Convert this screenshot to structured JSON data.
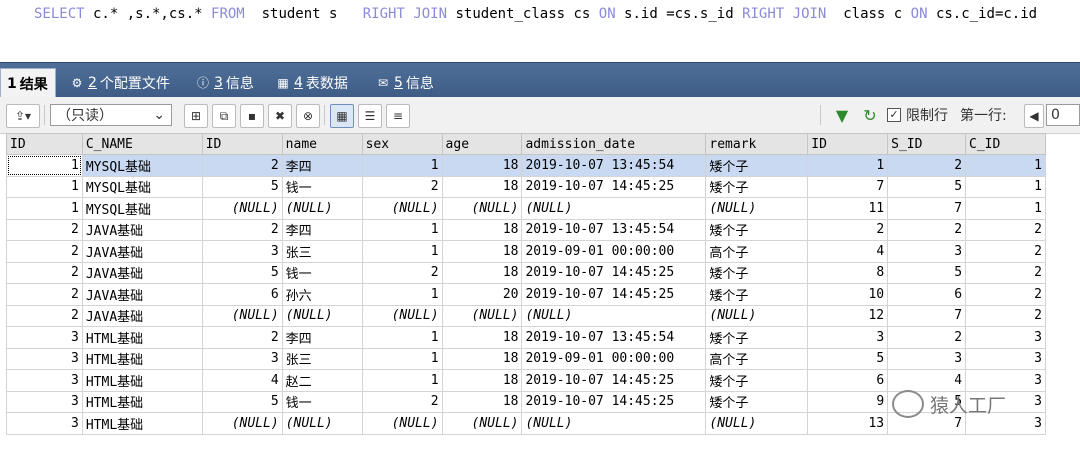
{
  "query": {
    "tokens": [
      {
        "t": "SELECT",
        "kw": true
      },
      {
        "t": " c.* ,s.*,cs.* ",
        "kw": false
      },
      {
        "t": "FROM",
        "kw": true
      },
      {
        "t": "  student s   ",
        "kw": false
      },
      {
        "t": "RIGHT JOIN",
        "kw": true
      },
      {
        "t": " student_class cs ",
        "kw": false
      },
      {
        "t": "ON",
        "kw": true
      },
      {
        "t": " s.id =cs.s_id ",
        "kw": false
      },
      {
        "t": "RIGHT JOIN",
        "kw": true
      },
      {
        "t": "  class c ",
        "kw": false
      },
      {
        "t": "ON",
        "kw": true
      },
      {
        "t": " cs.c_id=c.id",
        "kw": false
      }
    ]
  },
  "tabs": [
    {
      "num": "1",
      "label": "结果",
      "icon": "grid-icon"
    },
    {
      "num": "2",
      "label": "个配置文件",
      "icon": "profile-icon"
    },
    {
      "num": "3",
      "label": "信息",
      "icon": "info-icon"
    },
    {
      "num": "4",
      "label": "表数据",
      "icon": "table-icon"
    },
    {
      "num": "5",
      "label": "信息",
      "icon": "message-icon"
    }
  ],
  "toolbar": {
    "mode": "（只读）",
    "limit_label": "限制行",
    "first_row_label": "第一行:",
    "first_row_value": "0",
    "limit_checked": true
  },
  "columns": [
    "ID",
    "C_NAME",
    "ID",
    "name",
    "sex",
    "age",
    "admission_date",
    "remark",
    "ID",
    "S_ID",
    "C_ID"
  ],
  "rows": [
    [
      "1",
      "MYSQL基础",
      "2",
      "李四",
      "1",
      "18",
      "2019-10-07 13:45:54",
      "矮个子",
      "1",
      "2",
      "1"
    ],
    [
      "1",
      "MYSQL基础",
      "5",
      "钱一",
      "2",
      "18",
      "2019-10-07 14:45:25",
      "矮个子",
      "7",
      "5",
      "1"
    ],
    [
      "1",
      "MYSQL基础",
      "(NULL)",
      "(NULL)",
      "(NULL)",
      "(NULL)",
      "(NULL)",
      "(NULL)",
      "11",
      "7",
      "1"
    ],
    [
      "2",
      "JAVA基础",
      "2",
      "李四",
      "1",
      "18",
      "2019-10-07 13:45:54",
      "矮个子",
      "2",
      "2",
      "2"
    ],
    [
      "2",
      "JAVA基础",
      "3",
      "张三",
      "1",
      "18",
      "2019-09-01 00:00:00",
      "高个子",
      "4",
      "3",
      "2"
    ],
    [
      "2",
      "JAVA基础",
      "5",
      "钱一",
      "2",
      "18",
      "2019-10-07 14:45:25",
      "矮个子",
      "8",
      "5",
      "2"
    ],
    [
      "2",
      "JAVA基础",
      "6",
      "孙六",
      "1",
      "20",
      "2019-10-07 14:45:25",
      "矮个子",
      "10",
      "6",
      "2"
    ],
    [
      "2",
      "JAVA基础",
      "(NULL)",
      "(NULL)",
      "(NULL)",
      "(NULL)",
      "(NULL)",
      "(NULL)",
      "12",
      "7",
      "2"
    ],
    [
      "3",
      "HTML基础",
      "2",
      "李四",
      "1",
      "18",
      "2019-10-07 13:45:54",
      "矮个子",
      "3",
      "2",
      "3"
    ],
    [
      "3",
      "HTML基础",
      "3",
      "张三",
      "1",
      "18",
      "2019-09-01 00:00:00",
      "高个子",
      "5",
      "3",
      "3"
    ],
    [
      "3",
      "HTML基础",
      "4",
      "赵二",
      "1",
      "18",
      "2019-10-07 14:45:25",
      "矮个子",
      "6",
      "4",
      "3"
    ],
    [
      "3",
      "HTML基础",
      "5",
      "钱一",
      "2",
      "18",
      "2019-10-07 14:45:25",
      "矮个子",
      "9",
      "5",
      "3"
    ],
    [
      "3",
      "HTML基础",
      "(NULL)",
      "(NULL)",
      "(NULL)",
      "(NULL)",
      "(NULL)",
      "(NULL)",
      "13",
      "7",
      "3"
    ]
  ],
  "watermark": "猿人工厂",
  "colors": {
    "tabstrip": "#4a6a95",
    "selection": "#c9d9f2",
    "keyword": "#8a8ad8"
  }
}
